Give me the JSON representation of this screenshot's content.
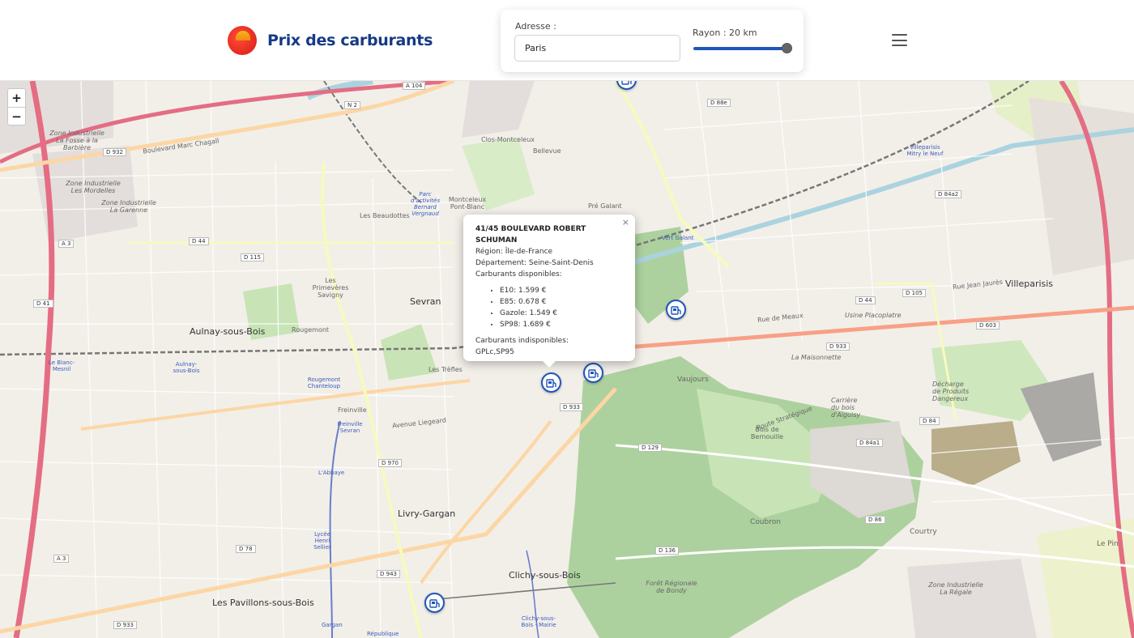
{
  "header": {
    "brand_title": "Prix des carburants"
  },
  "search": {
    "address_label": "Adresse :",
    "address_value": "Paris",
    "radius_label": "Rayon : 20 km",
    "radius_km": 20,
    "radius_fraction": 1.0
  },
  "map": {
    "zoom_in": "+",
    "zoom_out": "−",
    "labels": {
      "sevran": "Sevran",
      "aulnay": "Aulnay-sous-Bois",
      "livry": "Livry-Gargan",
      "clichy": "Clichy-sous-Bois",
      "pavillons": "Les Pavillons-sous-Bois",
      "villeparisis": "Villeparisis",
      "vaujours": "Vaujours",
      "coubron": "Coubron",
      "courtry": "Courtry",
      "beaudottes": "Les Beaudottes",
      "primeveres": "Les Primevères Savigny",
      "rougemont": "Rougemont",
      "treffles": "Les Trèfles",
      "freinville": "Freinville",
      "bellevue": "Bellevue",
      "clos_montceleux": "Clos-Montceleux",
      "montceleux": "Montceleux Pont-Blanc",
      "pre_galant": "Pré Galant",
      "vert_galant": "Vert Galant",
      "le_pin": "Le Pin",
      "zi_fosse": "Zone Industrielle La Fosse à la Barbière",
      "zi_mordelles": "Zone Industrielle Les Mordelles",
      "zi_garenne": "Zone Industrielle La Garenne",
      "zi_regale": "Zone Industrielle La Régale",
      "bois_bernouille": "Bois de Bernouille",
      "foret_bondy": "Forêt Régionale de Bondy",
      "villeparisis_mitry": "Villeparisis Mitry le Neuf",
      "le_blanc_mesnil": "Le Blanc-Mesnil",
      "aulnay_station": "Aulnay-sous-Bois",
      "rougemont_chanteloup": "Rougemont Chanteloup",
      "freinville_sevran": "Freinville Sevran",
      "abbaye": "L'Abbaye",
      "lycee": "Lycée Henri Sellier",
      "gargan": "Gargan",
      "republique": "République",
      "clichy_mairie": "Clichy-sous-Bois - Mairie",
      "boulevard_marc_chagall": "Boulevard Marc Chagall",
      "avenue_liegeard": "Avenue Liegeard",
      "route_strategique": "Route Stratégique",
      "rue_de_meaux": "Rue de Meaux",
      "rue_jean_jaures": "Rue Jean Jaurès",
      "parc_activites": "Parc d'activités Bernard Vergnaud",
      "carriere": "Carrière du bois d'Aiguisy",
      "decharge": "Décharge de Produits Dangereux",
      "uniplaco": "Usine Placoplatre",
      "maisonnette": "La Maisonnette"
    },
    "roads": {
      "a104": "A 104",
      "n2": "N 2",
      "d932": "D 932",
      "d44": "D 44",
      "d115": "D 115",
      "d41": "D 41",
      "a3": "A 3",
      "a3b": "A 3",
      "d933": "D 933",
      "d933b": "D 933",
      "d933c": "D 933",
      "d970": "D 970",
      "d78": "D 78",
      "d943": "D 943",
      "d129": "D 129",
      "d136": "D 136",
      "d84": "D 84",
      "d84a1": "D 84a1",
      "d84a2": "D 84a2",
      "d86": "D 86",
      "d88e": "D 88e",
      "d105": "D 105",
      "d44b": "D 44",
      "d603": "D 603"
    }
  },
  "popup": {
    "close": "×",
    "title": "41/45 BOULEVARD ROBERT SCHUMAN",
    "region": "Région: Île-de-France",
    "departement": "Département: Seine-Saint-Denis",
    "available_title": "Carburants disponibles:",
    "fuels": [
      "E10: 1.599 €",
      "E85: 0.678 €",
      "Gazole: 1.549 €",
      "SP98: 1.689 €"
    ],
    "unavailable_title": "Carburants indisponibles:",
    "unavailable": "GPLc,SP95"
  },
  "colors": {
    "brand": "#153a86",
    "accent": "#1f56b8",
    "motorway": "#e46d83",
    "primary_road": "#f6c884",
    "forest": "#add19e"
  },
  "icons": {
    "marker": "fuel-station-icon",
    "close": "close-icon",
    "menu": "hamburger-menu-icon"
  }
}
